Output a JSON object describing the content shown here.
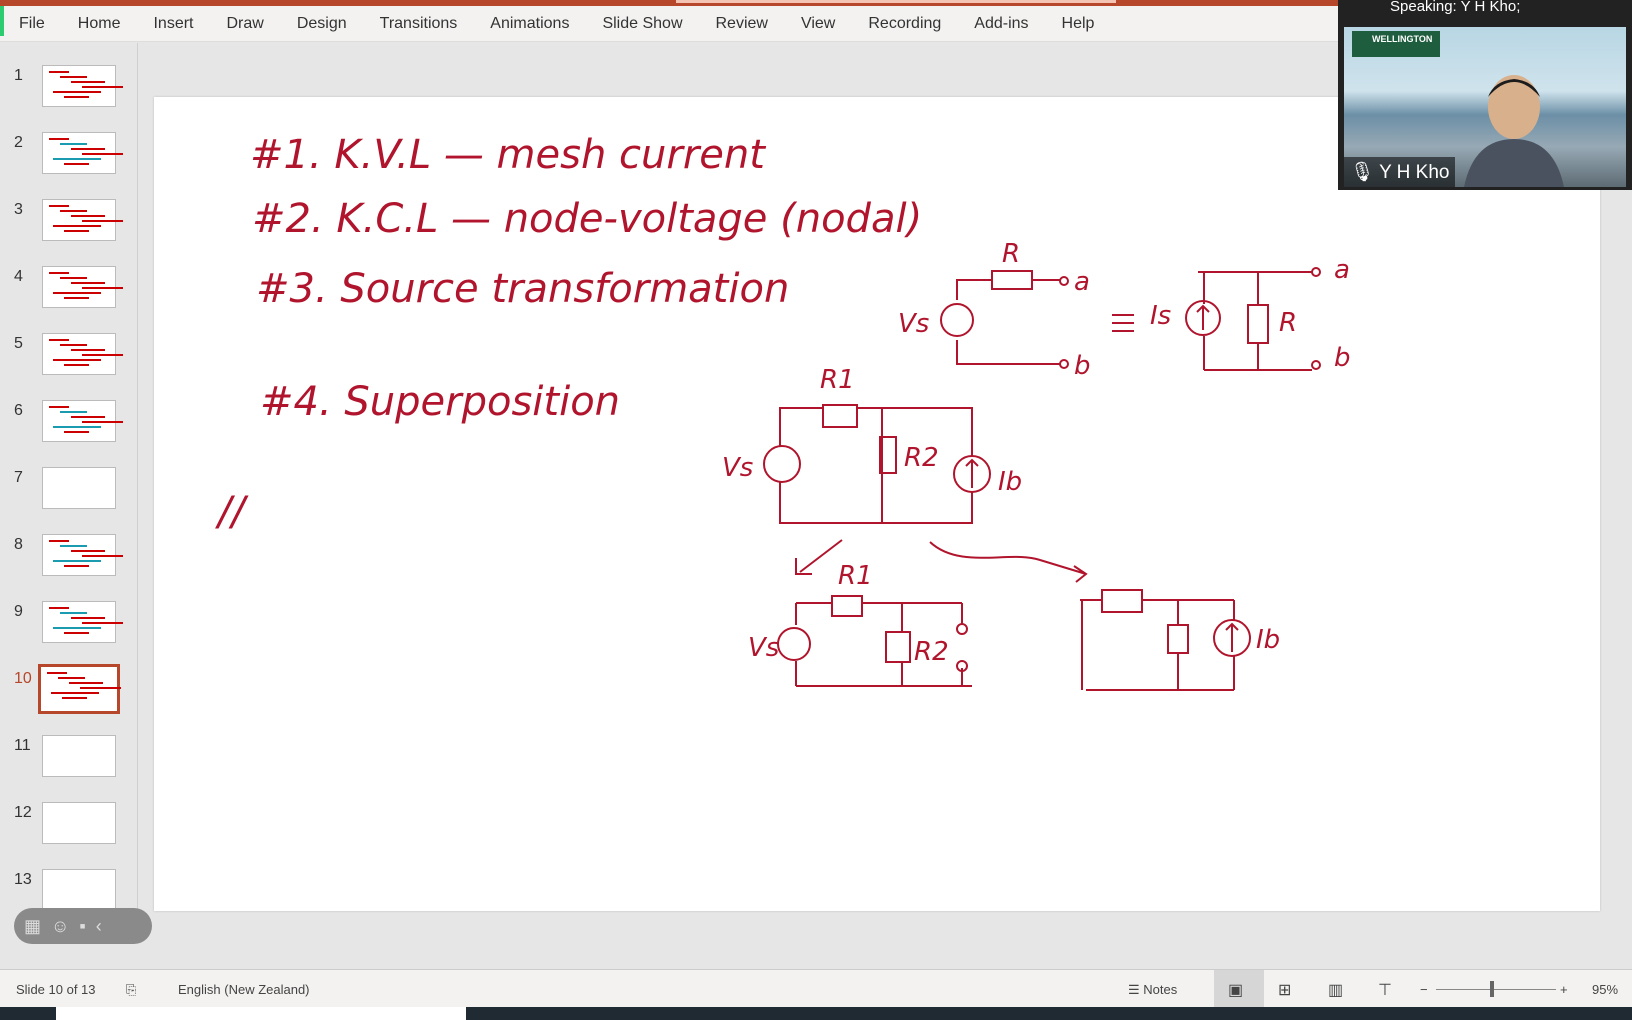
{
  "ribbon": {
    "tabs": [
      "File",
      "Home",
      "Insert",
      "Draw",
      "Design",
      "Transitions",
      "Animations",
      "Slide Show",
      "Review",
      "View",
      "Recording",
      "Add-ins",
      "Help"
    ]
  },
  "thumbnails": {
    "numbers": [
      "1",
      "2",
      "3",
      "4",
      "5",
      "6",
      "7",
      "8",
      "9",
      "10",
      "11",
      "12",
      "13"
    ],
    "active": "10"
  },
  "slide": {
    "lines": [
      "#1.  K.V.L  —  mesh current",
      "#2.  K.C.L  —  node-voltage (nodal)",
      "#3.  Source transformation",
      "#4.  Superposition",
      "//"
    ],
    "labels": {
      "R": "R",
      "a": "a",
      "b": "b",
      "Vs": "Vs",
      "Is": "Is",
      "equiv": "≡",
      "R1": "R1",
      "R2": "R2",
      "Ib": "Ib"
    },
    "ink_color": "#b0152d"
  },
  "video": {
    "speaking": "Speaking: Y H Kho;",
    "name": "Y H Kho",
    "logo": "WELLINGTON"
  },
  "status": {
    "slide": "Slide 10 of 13",
    "language": "English (New Zealand)",
    "notes": "Notes",
    "zoom": "95%",
    "minus": "−",
    "plus": "+"
  },
  "accent": "#b7472a"
}
